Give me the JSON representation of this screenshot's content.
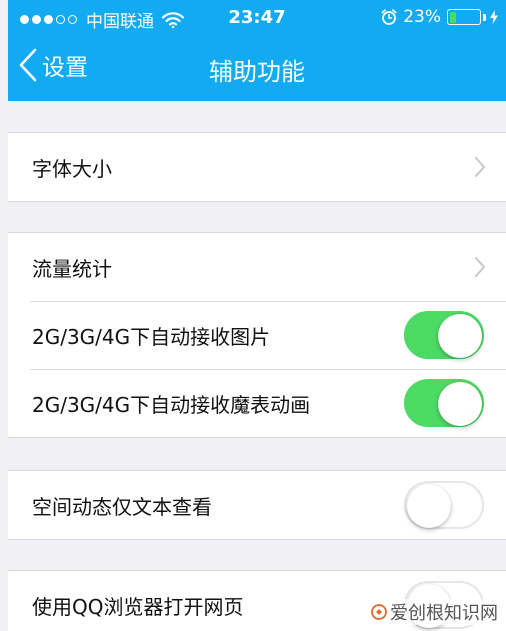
{
  "status_bar": {
    "carrier": "中国联通",
    "time": "23:47",
    "battery_percent": "23%",
    "battery_level": 0.23,
    "signal_filled": 3,
    "signal_total": 5
  },
  "nav": {
    "back_label": "设置",
    "title": "辅助功能"
  },
  "sections": [
    {
      "rows": [
        {
          "label": "字体大小",
          "control": "chevron"
        }
      ]
    },
    {
      "rows": [
        {
          "label": "流量统计",
          "control": "chevron"
        },
        {
          "label": "2G/3G/4G下自动接收图片",
          "control": "switch",
          "on": true
        },
        {
          "label": "2G/3G/4G下自动接收魔表动画",
          "control": "switch",
          "on": true
        }
      ]
    },
    {
      "rows": [
        {
          "label": "空间动态仅文本查看",
          "control": "switch",
          "on": false
        }
      ]
    },
    {
      "rows": [
        {
          "label": "使用QQ浏览器打开网页",
          "control": "switch",
          "on": false
        }
      ]
    }
  ],
  "watermark": {
    "text": "爱创根知识网"
  },
  "colors": {
    "accent": "#12aaf0",
    "switch_on": "#4cd964",
    "background": "#efeff4"
  },
  "icons": [
    "wifi-icon",
    "alarm-icon",
    "battery-icon",
    "charging-bolt-icon",
    "back-chevron-icon",
    "chevron-right-icon"
  ]
}
